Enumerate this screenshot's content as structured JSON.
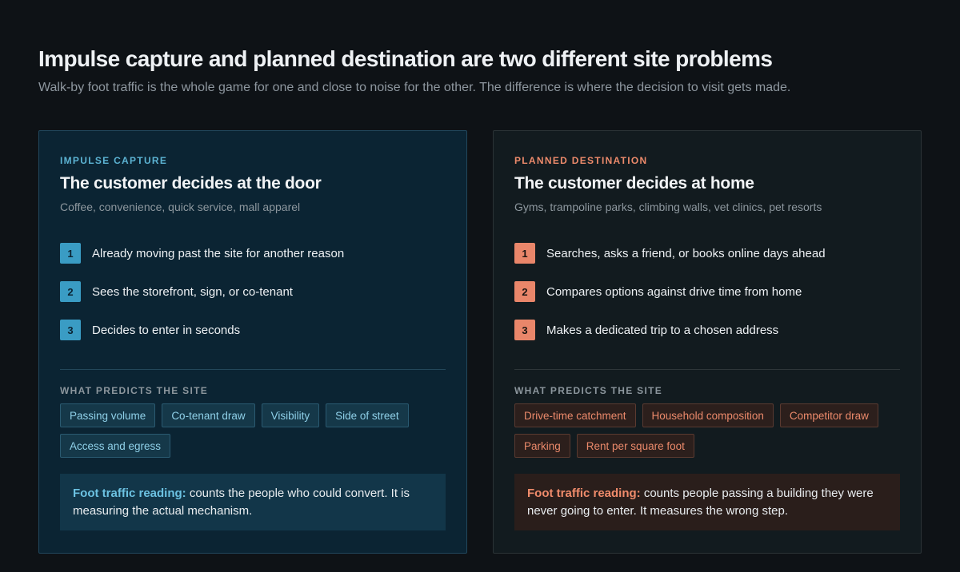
{
  "header": {
    "title": "Impulse capture and planned destination are two different site problems",
    "subtitle": "Walk-by foot traffic is the whole game for one and close to noise for the other. The difference is where the decision to visit gets made."
  },
  "impulse": {
    "eyebrow": "IMPULSE CAPTURE",
    "title": "The customer decides at the door",
    "subtitle": "Coffee, convenience, quick service, mall apparel",
    "steps": [
      {
        "num": "1",
        "text": "Already moving past the site for another reason"
      },
      {
        "num": "2",
        "text": "Sees the storefront, sign, or co-tenant"
      },
      {
        "num": "3",
        "text": "Decides to enter in seconds"
      }
    ],
    "predict_label": "WHAT PREDICTS THE SITE",
    "tags": [
      "Passing volume",
      "Co-tenant draw",
      "Visibility",
      "Side of street",
      "Access and egress"
    ],
    "reading_lead": "Foot traffic reading:",
    "reading_text": " counts the people who could convert. It is measuring the actual mechanism."
  },
  "planned": {
    "eyebrow": "PLANNED DESTINATION",
    "title": "The customer decides at home",
    "subtitle": "Gyms, trampoline parks, climbing walls, vet clinics, pet resorts",
    "steps": [
      {
        "num": "1",
        "text": "Searches, asks a friend, or books online days ahead"
      },
      {
        "num": "2",
        "text": "Compares options against drive time from home"
      },
      {
        "num": "3",
        "text": "Makes a dedicated trip to a chosen address"
      }
    ],
    "predict_label": "WHAT PREDICTS THE SITE",
    "tags": [
      "Drive-time catchment",
      "Household composition",
      "Competitor draw",
      "Parking",
      "Rent per square foot"
    ],
    "reading_lead": "Foot traffic reading:",
    "reading_text": " counts people passing a building they were never going to enter. It measures the wrong step."
  },
  "colors": {
    "background": "#0e1216",
    "impulse_accent": "#3a9cc4",
    "planned_accent": "#e9866a"
  }
}
